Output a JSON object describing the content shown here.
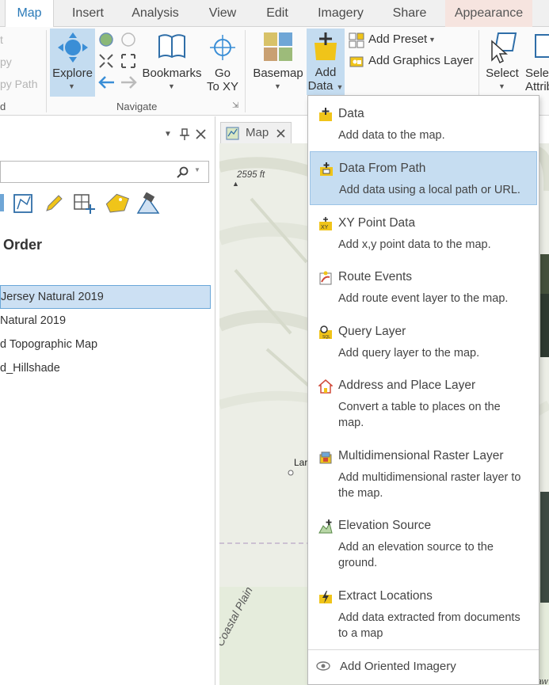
{
  "tabs": [
    {
      "label": "Map",
      "active": true
    },
    {
      "label": "Insert"
    },
    {
      "label": "Analysis"
    },
    {
      "label": "View"
    },
    {
      "label": "Edit"
    },
    {
      "label": "Imagery"
    },
    {
      "label": "Share"
    },
    {
      "label": "Appearance"
    }
  ],
  "ribbon": {
    "clipboard": {
      "item1": "t",
      "item2": "py",
      "item3": "py Path",
      "group": "d"
    },
    "navigate": {
      "explore": "Explore",
      "bookmarks": "Bookmarks",
      "goto_line1": "Go",
      "goto_line2": "To XY",
      "group": "Navigate"
    },
    "layer": {
      "basemap": "Basemap",
      "add_data_line1": "Add",
      "add_data_line2": "Data",
      "add_preset": "Add Preset",
      "add_graphics_layer": "Add Graphics Layer"
    },
    "selection": {
      "select": "Select",
      "select_by_attr": "Selec Attrib"
    }
  },
  "contents": {
    "title": "Order",
    "layers": [
      {
        "label": "Jersey Natural 2019",
        "selected": true
      },
      {
        "label": "Natural 2019"
      },
      {
        "label": "d Topographic Map"
      },
      {
        "label": "d_Hillshade"
      }
    ]
  },
  "map": {
    "tab_label": "Map",
    "elevation_label": "2595 ft",
    "place_label": "Lar",
    "region_label": "Coastal Plain",
    "corner_label": "Delaw"
  },
  "add_data_menu": {
    "items": [
      {
        "title": "Data",
        "desc": "Add data to the map."
      },
      {
        "title": "Data From Path",
        "desc": "Add data using a local path or URL.",
        "highlighted": true
      },
      {
        "title": "XY Point Data",
        "desc": "Add x,y point data to the map."
      },
      {
        "title": "Route Events",
        "desc": "Add route event layer to the map."
      },
      {
        "title": "Query Layer",
        "desc": "Add query layer to the map."
      },
      {
        "title": "Address and Place Layer",
        "desc": "Convert a table to places on the map."
      },
      {
        "title": "Multidimensional Raster Layer",
        "desc": "Add multidimensional raster layer to the map."
      },
      {
        "title": "Elevation Source",
        "desc": "Add an elevation source to the ground."
      },
      {
        "title": "Extract Locations",
        "desc": "Add data extracted from documents to a map"
      }
    ],
    "footer": "Add Oriented Imagery"
  },
  "colors": {
    "accent": "#2a7ab8",
    "highlight": "#c6ddf1",
    "appearance_tab": "#f6e4df",
    "icon_yellow": "#f0c419"
  }
}
